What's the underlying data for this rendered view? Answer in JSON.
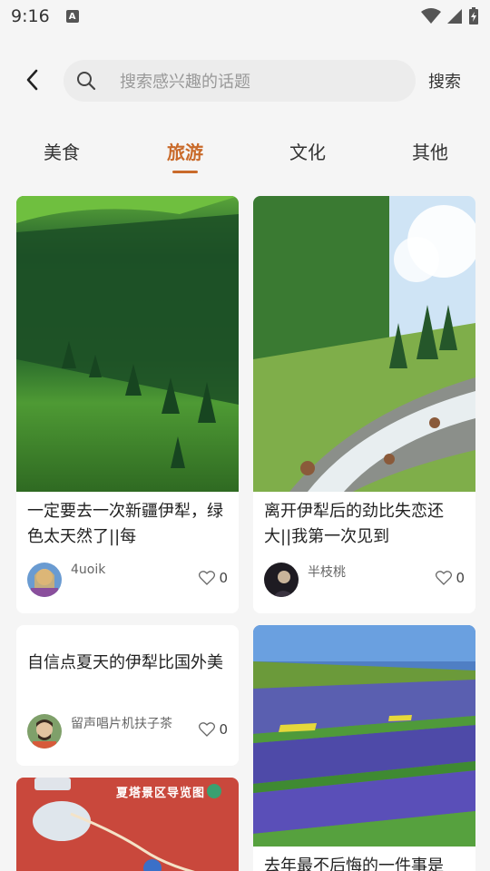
{
  "status": {
    "time": "9:16",
    "notification_letter": "A"
  },
  "search": {
    "placeholder": "搜索感兴趣的话题",
    "button": "搜索"
  },
  "tabs": [
    {
      "label": "美食"
    },
    {
      "label": "旅游",
      "active": true
    },
    {
      "label": "文化"
    },
    {
      "label": "其他"
    }
  ],
  "colors": {
    "accent": "#c96a2a",
    "background": "#f5f5f5"
  },
  "posts": [
    {
      "title": "一定要去一次新疆伊犁，绿色太天然了||每",
      "author": "4uoik",
      "likes": "0"
    },
    {
      "title": "离开伊犁后的劲比失恋还大||我第一次见到",
      "author": "半枝桃",
      "likes": "0"
    },
    {
      "title": "自信点夏天的伊犁比国外美",
      "author": "留声唱片机扶子茶",
      "likes": "0"
    },
    {
      "title": "去年最不后悔的一件事是",
      "author": "",
      "likes": ""
    },
    {
      "map_title": "夏塔景区导览图"
    }
  ]
}
